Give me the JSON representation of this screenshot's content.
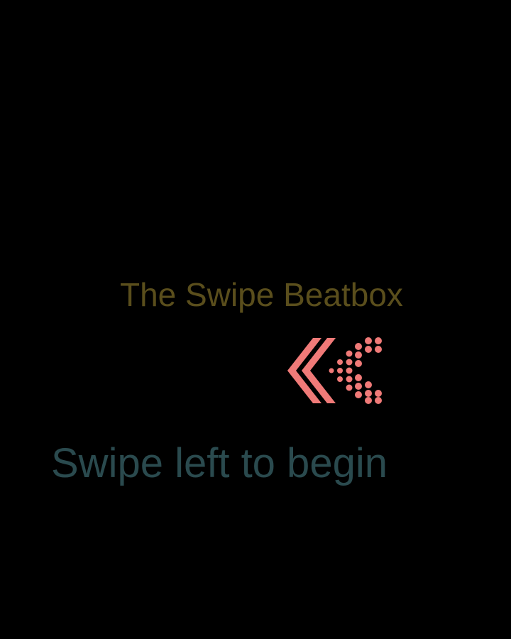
{
  "app": {
    "title": "The Swipe Beatbox",
    "hint": "Swipe left to begin"
  },
  "icons": {
    "swipe": "swipe-left-chevron-icon"
  },
  "colors": {
    "background": "#000000",
    "title": "#5a4e1c",
    "hint": "#2a4a4e",
    "icon": "#f07a78"
  }
}
